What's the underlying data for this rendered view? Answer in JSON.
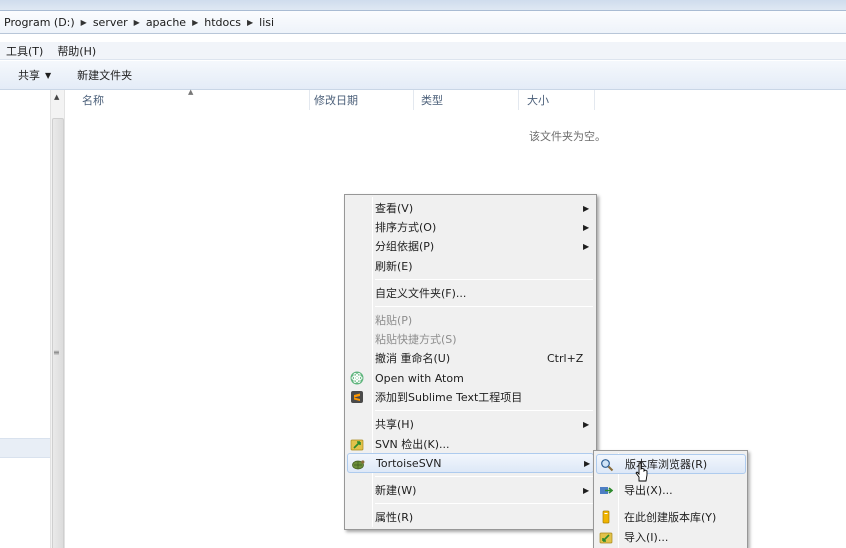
{
  "address": {
    "crumbs": [
      "Program (D:)",
      "server",
      "apache",
      "htdocs",
      "lisi"
    ]
  },
  "menubar": {
    "tools": "工具(T)",
    "help": "帮助(H)"
  },
  "commandbar": {
    "share": "共享",
    "new_folder": "新建文件夹"
  },
  "columns": {
    "name": "名称",
    "date": "修改日期",
    "type": "类型",
    "size": "大小"
  },
  "empty_message": "该文件夹为空。",
  "context_menu": {
    "view": "查看(V)",
    "sort_by": "排序方式(O)",
    "group_by": "分组依据(P)",
    "refresh": "刷新(E)",
    "customize": "自定义文件夹(F)...",
    "paste": "粘贴(P)",
    "paste_shortcut": "粘贴快捷方式(S)",
    "undo_rename": "撤消 重命名(U)",
    "undo_shortcut": "Ctrl+Z",
    "open_with_atom": "Open with Atom",
    "add_sublime": "添加到Sublime Text工程项目",
    "share": "共享(H)",
    "svn_checkout": "SVN 检出(K)...",
    "tortoisesvn": "TortoiseSVN",
    "new": "新建(W)",
    "properties": "属性(R)"
  },
  "submenu": {
    "repo_browser": "版本库浏览器(R)",
    "export": "导出(X)...",
    "create_repo": "在此创建版本库(Y)",
    "import": "导入(I)..."
  },
  "colors": {
    "hover_bg": "#dde8f7",
    "hover_border": "#aecbee",
    "menu_bg": "#f0f0f0",
    "disabled_text": "#8d8d8d"
  }
}
